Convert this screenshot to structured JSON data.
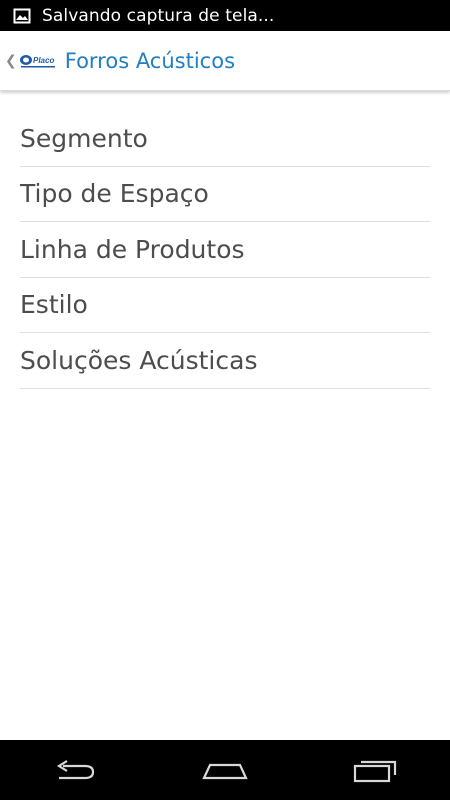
{
  "status_bar": {
    "notification_icon": "image-icon",
    "text": "Salvando captura de tela..."
  },
  "action_bar": {
    "up_icon": "chevron-left-icon",
    "logo_text": "Placo",
    "title": "Forros Acústicos",
    "title_color": "#1f7ec4"
  },
  "menu": {
    "items": [
      {
        "label": "Segmento"
      },
      {
        "label": "Tipo de Espaço"
      },
      {
        "label": "Linha de Produtos"
      },
      {
        "label": "Estilo"
      },
      {
        "label": "Soluções Acústicas"
      }
    ]
  },
  "nav_bar": {
    "back_icon": "back-icon",
    "home_icon": "home-icon",
    "recents_icon": "recent-apps-icon"
  }
}
